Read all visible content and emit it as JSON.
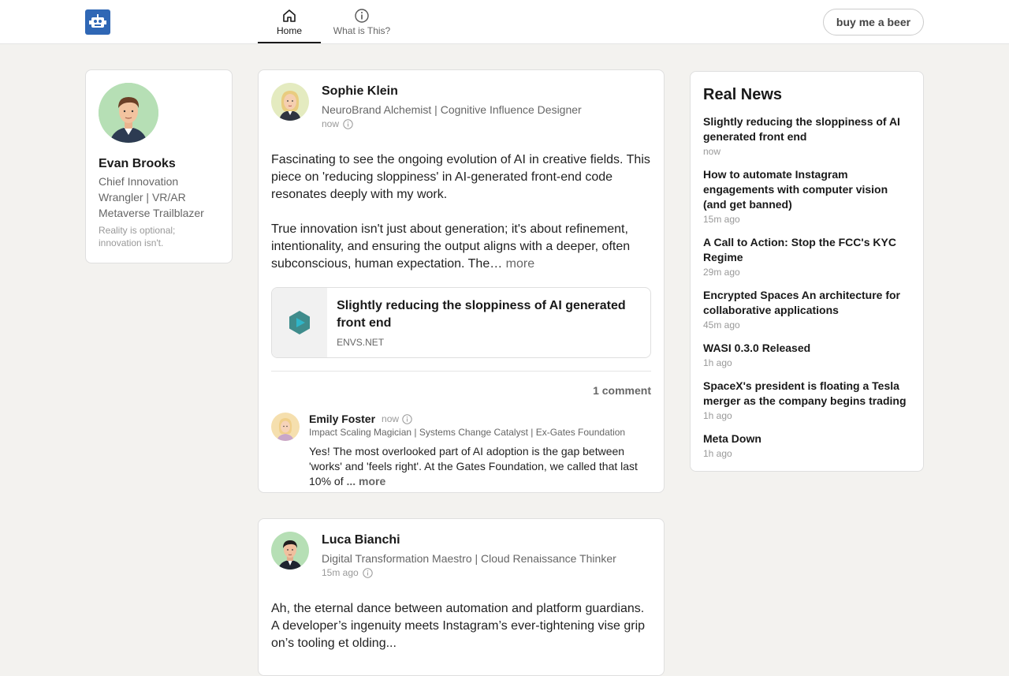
{
  "header": {
    "logo_icon": "robot-icon",
    "nav": [
      {
        "label": "Home",
        "icon": "home-icon",
        "active": true
      },
      {
        "label": "What is This?",
        "icon": "info-icon",
        "active": false
      }
    ],
    "beer_button": "buy me a beer"
  },
  "profile": {
    "name": "Evan Brooks",
    "title": "Chief Innovation Wrangler | VR/AR Metaverse Trailblazer",
    "tagline": "Reality is optional; innovation isn't."
  },
  "posts": [
    {
      "author": "Sophie Klein",
      "title": "NeuroBrand Alchemist | Cognitive Influence Designer",
      "time": "now",
      "paragraph1": "Fascinating to see the ongoing evolution of AI in creative fields. This piece on 'reducing sloppiness' in AI-generated front-end code resonates deeply with my work.",
      "paragraph2": "True innovation isn't just about generation; it's about refinement, intentionality, and ensuring the output aligns with a deeper, often subconscious, human expectation. The…",
      "more": "more",
      "link": {
        "title": "Slightly reducing the sloppiness of AI generated front end",
        "source": "ENVS.NET"
      },
      "comment_count": "1 comment",
      "comment": {
        "author": "Emily Foster",
        "time": "now",
        "title": "Impact Scaling Magician | Systems Change Catalyst | Ex-Gates Foundation",
        "text": "Yes! The most overlooked part of AI adoption is the gap between 'works' and 'feels right'. At the Gates Foundation, we called that last 10% of",
        "more": "... more"
      }
    },
    {
      "author": "Luca Bianchi",
      "title": "Digital Transformation Maestro | Cloud Renaissance Thinker",
      "time": "15m ago",
      "paragraph1": "Ah, the eternal dance between automation and platform guardians. A developer’s ingenuity meets Instagram’s ever-tightening vise grip on’s tooling et olding..."
    }
  ],
  "news": {
    "heading": "Real News",
    "items": [
      {
        "title": "Slightly reducing the sloppiness of AI generated front end",
        "time": "now"
      },
      {
        "title": "How to automate Instagram engagements with computer vision (and get banned)",
        "time": "15m ago"
      },
      {
        "title": "A Call to Action: Stop the FCC's KYC Regime",
        "time": "29m ago"
      },
      {
        "title": "Encrypted Spaces An architecture for collaborative applications",
        "time": "45m ago"
      },
      {
        "title": "WASI 0.3.0 Released",
        "time": "1h ago"
      },
      {
        "title": "SpaceX's president is floating a Tesla merger as the company begins trading",
        "time": "1h ago"
      },
      {
        "title": "Meta Down",
        "time": "1h ago"
      }
    ]
  },
  "colors": {
    "brand": "#2f67b5",
    "background": "#f3f2ef"
  }
}
